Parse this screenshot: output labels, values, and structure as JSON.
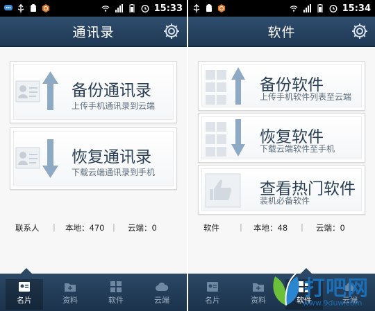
{
  "left": {
    "status": {
      "time": "15:33"
    },
    "title": "通讯录",
    "cards": [
      {
        "title": "备份通讯录",
        "subtitle": "上传手机通讯录到云端",
        "art": "contact-upload-icon"
      },
      {
        "title": "恢复通讯录",
        "subtitle": "下载云端通讯录到手机",
        "art": "contact-download-icon"
      }
    ],
    "stats": {
      "label": "联系人",
      "local": "本地：470",
      "cloud": "云端：0"
    },
    "tabs": [
      {
        "label": "名片",
        "icon": "card-icon",
        "active": true
      },
      {
        "label": "资料",
        "icon": "folder-icon"
      },
      {
        "label": "软件",
        "icon": "apps-icon"
      },
      {
        "label": "云端",
        "icon": "cloud-icon"
      }
    ]
  },
  "right": {
    "status": {
      "time": "15:34"
    },
    "title": "软件",
    "cards": [
      {
        "title": "备份软件",
        "subtitle": "上传手机软件列表至云端",
        "art": "apps-upload-icon"
      },
      {
        "title": "恢复软件",
        "subtitle": "下载云端软件至手机",
        "art": "apps-download-icon"
      },
      {
        "title": "查看热门软件",
        "subtitle": "装机必备软件",
        "art": "thumbs-up-icon"
      }
    ],
    "stats": {
      "label": "软件",
      "local": "本地：48",
      "cloud": "云端：0"
    },
    "tabs": [
      {
        "label": "名片",
        "icon": "card-icon"
      },
      {
        "label": "资料",
        "icon": "folder-icon"
      },
      {
        "label": "软件",
        "icon": "apps-icon",
        "active": true
      },
      {
        "label": "云端",
        "icon": "cloud-icon"
      }
    ]
  },
  "watermark": {
    "text": "打吧网",
    "url": "www.9duw.com"
  },
  "colors": {
    "header": "#27435f",
    "accent_arrow": "#6f8fb0",
    "text_dark": "#2a3f55"
  }
}
